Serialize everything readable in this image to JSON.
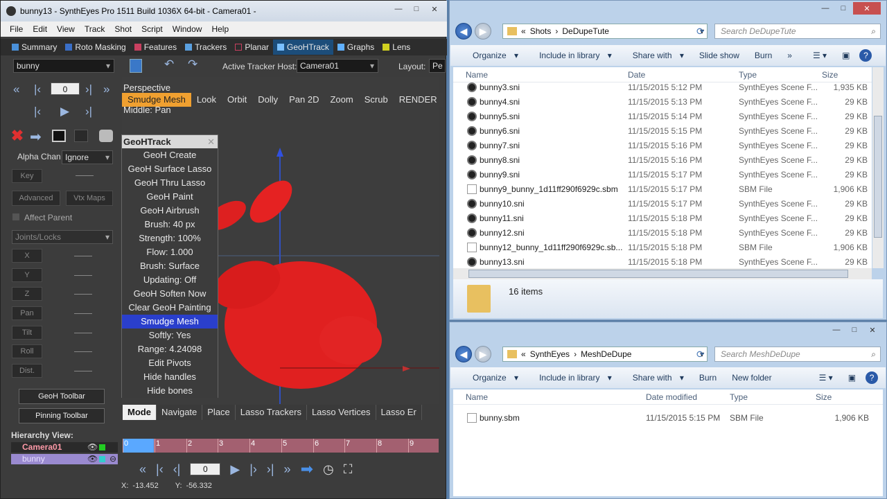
{
  "syntheyes": {
    "title": "bunny13 - SynthEyes Pro 1511 Build 1036X 64-bit - Camera01 -",
    "menu": [
      "File",
      "Edit",
      "View",
      "Track",
      "Shot",
      "Script",
      "Window",
      "Help"
    ],
    "tabs": [
      {
        "label": "Summary",
        "active": false
      },
      {
        "label": "Roto Masking",
        "active": false
      },
      {
        "label": "Features",
        "active": false
      },
      {
        "label": "Trackers",
        "active": false
      },
      {
        "label": "Planar",
        "active": false
      },
      {
        "label": "GeoHTrack",
        "active": true
      },
      {
        "label": "Graphs",
        "active": false
      },
      {
        "label": "Lens",
        "active": false
      }
    ],
    "object_select": "bunny",
    "active_tracker_host_label": "Active Tracker Host:",
    "active_tracker_host": "Camera01",
    "layout_label": "Layout:",
    "layout_value": "Pe",
    "frame_value": "0",
    "alpha_label": "Alpha Chan",
    "alpha_value": "Ignore",
    "key_label": "Key",
    "advanced_label": "Advanced",
    "vtx_maps_label": "Vtx Maps",
    "affect_parent_label": "Affect Parent",
    "joints_label": "Joints/Locks",
    "fields": [
      "X",
      "Y",
      "Z",
      "Pan",
      "Tilt",
      "Roll",
      "Dist."
    ],
    "geoh_toolbar_label": "GeoH Toolbar",
    "pinning_toolbar_label": "Pinning Toolbar",
    "hierarchy_label": "Hierarchy View:",
    "hierarchy": [
      {
        "name": "Camera01"
      },
      {
        "name": "bunny"
      }
    ],
    "viewport": {
      "name": "Perspective",
      "hint": "Middle: Pan",
      "menu": [
        "Smudge Mesh",
        "Look",
        "Orbit",
        "Dolly",
        "Pan 2D",
        "Zoom",
        "Scrub",
        "RENDER"
      ]
    },
    "geoh_panel": {
      "title": "GeoHTrack",
      "items": [
        "GeoH Create",
        "GeoH Surface Lasso",
        "GeoH Thru Lasso",
        "GeoH Paint",
        "GeoH Airbrush",
        "Brush: 40 px",
        "Strength: 100%",
        "Flow: 1.000",
        "Brush: Surface",
        "Updating: Off",
        "GeoH Soften Now",
        "Clear GeoH Painting",
        "Smudge Mesh",
        "Softly: Yes",
        "Range: 4.24098",
        "Edit Pivots",
        "Hide handles",
        "Hide bones"
      ],
      "selected": "Smudge Mesh"
    },
    "mode_bar": [
      "Mode",
      "Navigate",
      "Place",
      "Lasso Trackers",
      "Lasso Vertices",
      "Lasso Er"
    ],
    "timeline_ticks": [
      "0",
      "1",
      "2",
      "3",
      "4",
      "5",
      "6",
      "7",
      "8",
      "9"
    ],
    "play_frame": "0",
    "status": {
      "x_label": "X:",
      "x": "-13.452",
      "y_label": "Y:",
      "y": "-56.332"
    }
  },
  "explorer_top": {
    "path": [
      "Shots",
      "DeDupeTute"
    ],
    "search_placeholder": "Search DeDupeTute",
    "commands": [
      "Organize",
      "Include in library",
      "Share with",
      "Slide show",
      "Burn"
    ],
    "columns": [
      "Name",
      "Date",
      "Type",
      "Size"
    ],
    "files": [
      {
        "name": "bunny3.sni",
        "date": "11/15/2015 5:12 PM",
        "type": "SynthEyes Scene F...",
        "size": "1,935 KB",
        "kind": "sni"
      },
      {
        "name": "bunny4.sni",
        "date": "11/15/2015 5:13 PM",
        "type": "SynthEyes Scene F...",
        "size": "29 KB",
        "kind": "sni"
      },
      {
        "name": "bunny5.sni",
        "date": "11/15/2015 5:14 PM",
        "type": "SynthEyes Scene F...",
        "size": "29 KB",
        "kind": "sni"
      },
      {
        "name": "bunny6.sni",
        "date": "11/15/2015 5:15 PM",
        "type": "SynthEyes Scene F...",
        "size": "29 KB",
        "kind": "sni"
      },
      {
        "name": "bunny7.sni",
        "date": "11/15/2015 5:16 PM",
        "type": "SynthEyes Scene F...",
        "size": "29 KB",
        "kind": "sni"
      },
      {
        "name": "bunny8.sni",
        "date": "11/15/2015 5:16 PM",
        "type": "SynthEyes Scene F...",
        "size": "29 KB",
        "kind": "sni"
      },
      {
        "name": "bunny9.sni",
        "date": "11/15/2015 5:17 PM",
        "type": "SynthEyes Scene F...",
        "size": "29 KB",
        "kind": "sni"
      },
      {
        "name": "bunny9_bunny_1d11ff290f6929c.sbm",
        "date": "11/15/2015 5:17 PM",
        "type": "SBM File",
        "size": "1,906 KB",
        "kind": "doc"
      },
      {
        "name": "bunny10.sni",
        "date": "11/15/2015 5:17 PM",
        "type": "SynthEyes Scene F...",
        "size": "29 KB",
        "kind": "sni"
      },
      {
        "name": "bunny11.sni",
        "date": "11/15/2015 5:18 PM",
        "type": "SynthEyes Scene F...",
        "size": "29 KB",
        "kind": "sni"
      },
      {
        "name": "bunny12.sni",
        "date": "11/15/2015 5:18 PM",
        "type": "SynthEyes Scene F...",
        "size": "29 KB",
        "kind": "sni"
      },
      {
        "name": "bunny12_bunny_1d11ff290f6929c.sb...",
        "date": "11/15/2015 5:18 PM",
        "type": "SBM File",
        "size": "1,906 KB",
        "kind": "doc"
      },
      {
        "name": "bunny13.sni",
        "date": "11/15/2015 5:18 PM",
        "type": "SynthEyes Scene F...",
        "size": "29 KB",
        "kind": "sni"
      }
    ],
    "item_count": "16 items"
  },
  "explorer_bottom": {
    "path": [
      "SynthEyes",
      "MeshDeDupe"
    ],
    "search_placeholder": "Search MeshDeDupe",
    "commands": [
      "Organize",
      "Include in library",
      "Share with",
      "Burn",
      "New folder"
    ],
    "columns": [
      "Name",
      "Date modified",
      "Type",
      "Size"
    ],
    "files": [
      {
        "name": "bunny.sbm",
        "date": "11/15/2015 5:15 PM",
        "type": "SBM File",
        "size": "1,906 KB",
        "kind": "doc"
      }
    ]
  }
}
